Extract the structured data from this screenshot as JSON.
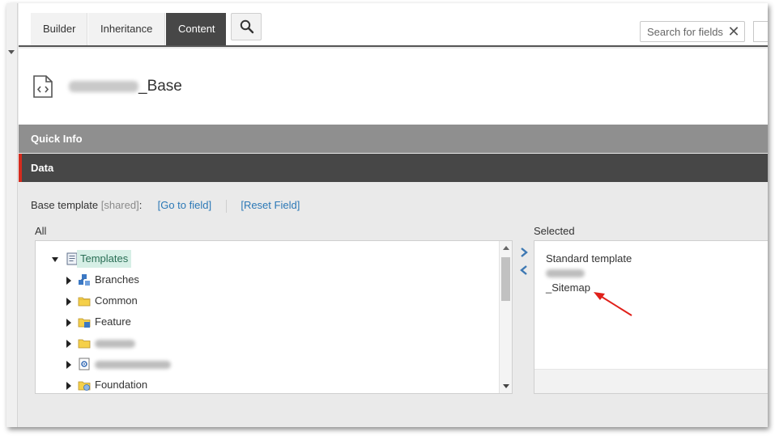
{
  "tabs": [
    {
      "label": "Builder",
      "active": false
    },
    {
      "label": "Inheritance",
      "active": false
    },
    {
      "label": "Content",
      "active": true
    }
  ],
  "search": {
    "placeholder": "Search for fields",
    "clear_glyph": "✕"
  },
  "item": {
    "title_suffix": "_Base",
    "icon": "template-code-icon"
  },
  "sections": {
    "quick_info": "Quick Info",
    "data": "Data"
  },
  "field": {
    "label": "Base template",
    "shared": "[shared]",
    "colon": ":",
    "go_to_field": "[Go to field]",
    "reset_field": "[Reset Field]"
  },
  "tree": {
    "header": "All",
    "items": [
      {
        "label": "Templates",
        "icon": "templates-icon",
        "expanded": true
      },
      {
        "label": "Branches",
        "icon": "branches-icon"
      },
      {
        "label": "Common",
        "icon": "folder-icon"
      },
      {
        "label": "Feature",
        "icon": "feature-folder-icon"
      },
      {
        "label": "",
        "icon": "folder-icon"
      },
      {
        "label": "",
        "icon": "gear-template-icon"
      },
      {
        "label": "Foundation",
        "icon": "foundation-icon"
      }
    ]
  },
  "selected": {
    "header": "Selected",
    "items": [
      "Standard template",
      "",
      "_Sitemap"
    ]
  },
  "colors": {
    "accent_red": "#d52b1e",
    "active_tab": "#474747",
    "link": "#2b78b6",
    "arrow_annotation": "#e0201a"
  }
}
